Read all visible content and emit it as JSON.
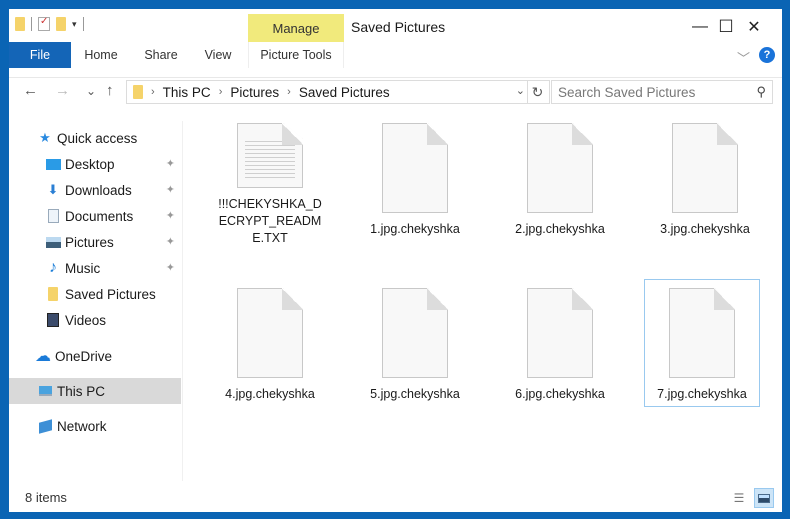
{
  "window": {
    "title": "Saved Pictures",
    "controls": {
      "minimize": "—",
      "maximize": "☐",
      "close": "✕"
    }
  },
  "quick_access_toolbar": {
    "dropdown": "▾"
  },
  "ribbon": {
    "contextual_group": "Manage",
    "tabs": [
      {
        "label": "File",
        "active": true
      },
      {
        "label": "Home"
      },
      {
        "label": "Share"
      },
      {
        "label": "View"
      },
      {
        "label": "Picture Tools"
      }
    ],
    "collapse_icon": "﹀",
    "help_icon": "?"
  },
  "navigation": {
    "back": "←",
    "forward": "→",
    "recent": "⌄",
    "up": "↑",
    "breadcrumb": [
      "This PC",
      "Pictures",
      "Saved Pictures"
    ],
    "breadcrumb_separator": "›",
    "address_dropdown": "⌄",
    "refresh": "↻",
    "search_placeholder": "Search Saved Pictures",
    "search_icon": "⚲"
  },
  "sidebar": {
    "items": [
      {
        "label": "Quick access",
        "icon": "star-icon",
        "glyph": "★",
        "color": "#2a8ae0"
      },
      {
        "label": "Desktop",
        "icon": "desktop-icon",
        "pinned": true
      },
      {
        "label": "Downloads",
        "icon": "download-icon",
        "glyph": "⬇",
        "color": "#2a7fd4",
        "pinned": true
      },
      {
        "label": "Documents",
        "icon": "documents-icon",
        "pinned": true
      },
      {
        "label": "Pictures",
        "icon": "pictures-icon",
        "pinned": true
      },
      {
        "label": "Music",
        "icon": "music-icon",
        "glyph": "♪",
        "color": "#1e7fd8",
        "pinned": true
      },
      {
        "label": "Saved Pictures",
        "icon": "folder-icon"
      },
      {
        "label": "Videos",
        "icon": "videos-icon"
      },
      {
        "label": "OneDrive",
        "icon": "onedrive-icon",
        "glyph": "☁",
        "color": "#1a7ad8"
      },
      {
        "label": "This PC",
        "icon": "this-pc-icon",
        "selected": true
      },
      {
        "label": "Network",
        "icon": "network-icon"
      }
    ],
    "pin_glyph": "📌"
  },
  "files": [
    {
      "name": "!!!CHEKYSHKA_DECRYPT_README.TXT",
      "type": "txt"
    },
    {
      "name": "1.jpg.chekyshka",
      "type": "unknown"
    },
    {
      "name": "2.jpg.chekyshka",
      "type": "unknown"
    },
    {
      "name": "3.jpg.chekyshka",
      "type": "unknown"
    },
    {
      "name": "4.jpg.chekyshka",
      "type": "unknown"
    },
    {
      "name": "5.jpg.chekyshka",
      "type": "unknown"
    },
    {
      "name": "6.jpg.chekyshka",
      "type": "unknown"
    },
    {
      "name": "7.jpg.chekyshka",
      "type": "unknown",
      "focused": true
    }
  ],
  "status_bar": {
    "item_count": "8 items",
    "details_view_icon": "☰"
  },
  "colors": {
    "accent": "#1465b7",
    "manage_tab": "#f1ea7c",
    "selection": "#d9d9d9",
    "focus_border": "#99c9ef"
  }
}
